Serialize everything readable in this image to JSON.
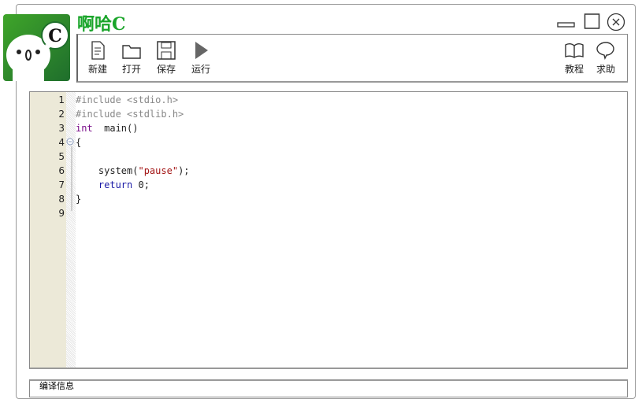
{
  "app": {
    "title": "啊哈C",
    "logo_letter": "C"
  },
  "toolbar": {
    "new": "新建",
    "open": "打开",
    "save": "保存",
    "run": "运行",
    "tutorial": "教程",
    "help": "求助"
  },
  "editor": {
    "lines": [
      {
        "n": "1",
        "parts": [
          [
            "pp",
            "#include <stdio.h>"
          ]
        ]
      },
      {
        "n": "2",
        "parts": [
          [
            "pp",
            "#include <stdlib.h>"
          ]
        ]
      },
      {
        "n": "3",
        "parts": [
          [
            "kw",
            "int"
          ],
          [
            "",
            "  main()"
          ]
        ]
      },
      {
        "n": "4",
        "parts": [
          [
            "",
            "{"
          ]
        ]
      },
      {
        "n": "5",
        "parts": []
      },
      {
        "n": "6",
        "parts": [
          [
            "",
            "    system("
          ],
          [
            "str",
            "\"pause\""
          ],
          [
            "",
            ");"
          ]
        ]
      },
      {
        "n": "7",
        "parts": [
          [
            "blue",
            "    return"
          ],
          [
            "",
            " 0;"
          ]
        ]
      },
      {
        "n": "8",
        "parts": [
          [
            "",
            "}"
          ]
        ]
      },
      {
        "n": "9",
        "parts": []
      }
    ]
  },
  "bottom_panel": {
    "label": "编译信息"
  }
}
